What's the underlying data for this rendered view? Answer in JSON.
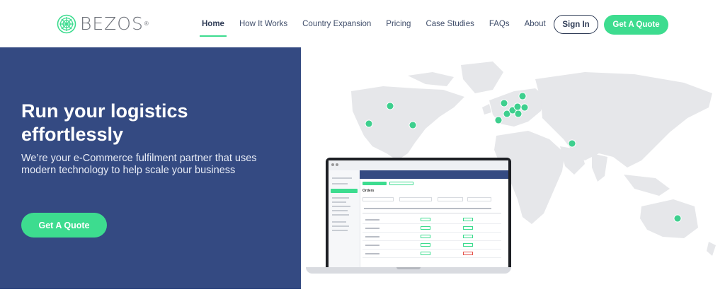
{
  "brand": {
    "name": "BEZOS",
    "registered": "®",
    "accent": "#3ddc8f",
    "primary": "#344a82"
  },
  "nav": {
    "items": [
      {
        "label": "Home",
        "active": true
      },
      {
        "label": "How It Works"
      },
      {
        "label": "Country Expansion"
      },
      {
        "label": "Pricing"
      },
      {
        "label": "Case Studies"
      },
      {
        "label": "FAQs"
      },
      {
        "label": "About"
      }
    ],
    "signin": "Sign In",
    "quote": "Get A Quote"
  },
  "hero": {
    "title": "Run your logistics effortlessly",
    "subtitle": "We’re your e-Commerce fulfilment partner that uses modern technology to help scale your business",
    "cta": "Get A Quote"
  },
  "laptop_app": {
    "section": "Orders"
  }
}
